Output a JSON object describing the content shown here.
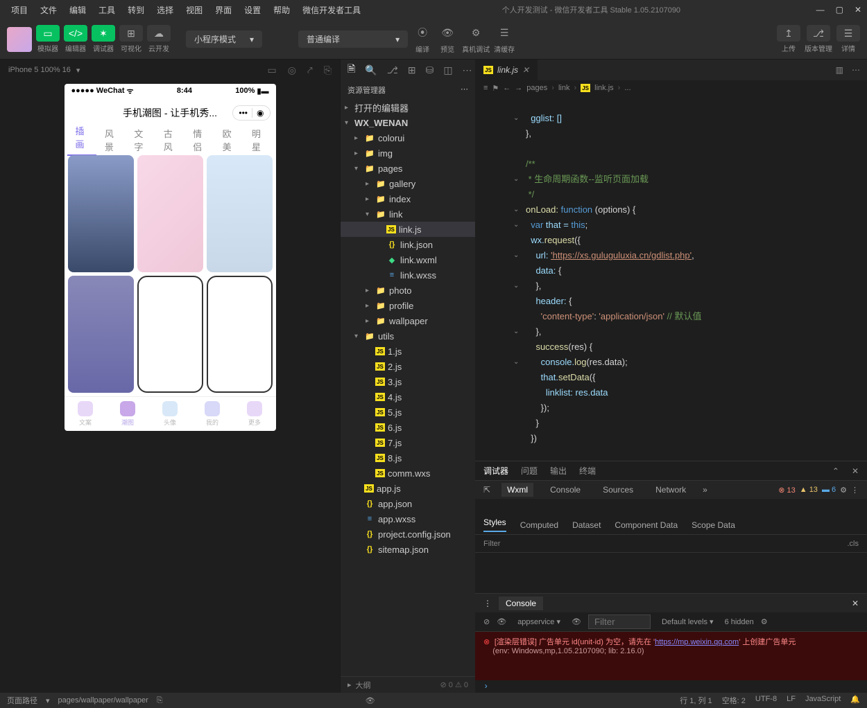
{
  "menubar": [
    "项目",
    "文件",
    "编辑",
    "工具",
    "转到",
    "选择",
    "视图",
    "界面",
    "设置",
    "帮助",
    "微信开发者工具"
  ],
  "window_title": "个人开发测试 - 微信开发者工具 Stable 1.05.2107090",
  "toolbar": {
    "sim": "模拟器",
    "edit": "编辑器",
    "debug": "调试器",
    "vis": "可视化",
    "cloud": "云开发",
    "mode": "小程序模式",
    "compile": "普通编译",
    "c1": "编译",
    "c2": "预览",
    "c3": "真机调试",
    "c4": "清缓存",
    "r1": "上传",
    "r2": "版本管理",
    "r3": "详情"
  },
  "sim": {
    "device": "iPhone 5 100% 16",
    "wechat": "●●●●● WeChat",
    "time": "8:44",
    "battery": "100%",
    "title": "手机潮图 - 让手机秀...",
    "tabs": [
      "插画",
      "风景",
      "文字",
      "古风",
      "情侣",
      "欧美",
      "明星"
    ],
    "bottom": [
      "文案",
      "潮图",
      "头像",
      "我的",
      "更多"
    ]
  },
  "explorer": {
    "header": "资源管理器",
    "section1": "打开的编辑器",
    "root": "WX_WENAN",
    "items": {
      "colorui": "colorui",
      "img": "img",
      "pages": "pages",
      "gallery": "gallery",
      "index": "index",
      "link": "link",
      "linkjs": "link.js",
      "linkjson": "link.json",
      "linkwxml": "link.wxml",
      "linkwxss": "link.wxss",
      "photo": "photo",
      "profile": "profile",
      "wallpaper": "wallpaper",
      "utils": "utils",
      "u1": "1.js",
      "u2": "2.js",
      "u3": "3.js",
      "u4": "4.js",
      "u5": "5.js",
      "u6": "6.js",
      "u7": "7.js",
      "u8": "8.js",
      "comm": "comm.wxs",
      "appjs": "app.js",
      "appjson": "app.json",
      "appwxss": "app.wxss",
      "pcfg": "project.config.json",
      "sitemap": "sitemap.json"
    },
    "outline": "大纲",
    "outline_stats": "0 ⚠ 0"
  },
  "editor": {
    "tab": "link.js",
    "crumbs": [
      "pages",
      "link",
      "link.js",
      "..."
    ],
    "lines": {
      "gglist": "gglist: []",
      "c1": "/**",
      "c2": " * 生命周期函数--监听页面加载",
      "c3": " */",
      "onload_a": "onLoad:",
      "onload_b": "function",
      "onload_c": "(options) {",
      "var": "var",
      "that": "that = ",
      "this": "this",
      "wxreq": "wx.",
      "req": "request",
      "open": "({",
      "url_k": "url:",
      "url_v": "'https://xs.guluguluxia.cn/gdlist.php'",
      "data_k": "data:",
      "brace": "{",
      "cbrace": "},",
      "header_k": "header:",
      "ct_k": "'content-type'",
      "ct_v": "'application/json'",
      "ct_c": "// 默认值",
      "succ": "success",
      "res": "(res) {",
      "log": "console.",
      "logfn": "log",
      "logarg": "(res.data);",
      "setdata": "that.",
      "setdata_fn": "setData",
      "setdata_o": "({",
      "ll": "linklist: res.data",
      "close1": "});",
      "close2": "}",
      "close3": "})"
    }
  },
  "debugger": {
    "tabs": [
      "调试器",
      "问题",
      "输出",
      "终端"
    ],
    "subtabs": [
      "Wxml",
      "Console",
      "Sources",
      "Network"
    ],
    "err_count": "13",
    "warn_count": "13",
    "info_count": "6",
    "styles_tabs": [
      "Styles",
      "Computed",
      "Dataset",
      "Component Data",
      "Scope Data"
    ],
    "filter": "Filter",
    "cls": ".cls",
    "console": "Console",
    "appservice": "appservice",
    "defaultlevels": "Default levels",
    "hidden": "6 hidden",
    "err_line": "[渲染层错误] 广告单元 id(unit-id) 为空，请先在 '",
    "err_url": "https://mp.weixin.qq.com",
    "err_line2": "' 上创建广告单元",
    "env": "(env: Windows,mp,1.05.2107090; lib: 2.16.0)"
  },
  "status": {
    "path_lbl": "页面路径",
    "path": "pages/wallpaper/wallpaper",
    "pos": "行 1, 列 1",
    "spaces": "空格: 2",
    "enc": "UTF-8",
    "eol": "LF",
    "lang": "JavaScript"
  }
}
